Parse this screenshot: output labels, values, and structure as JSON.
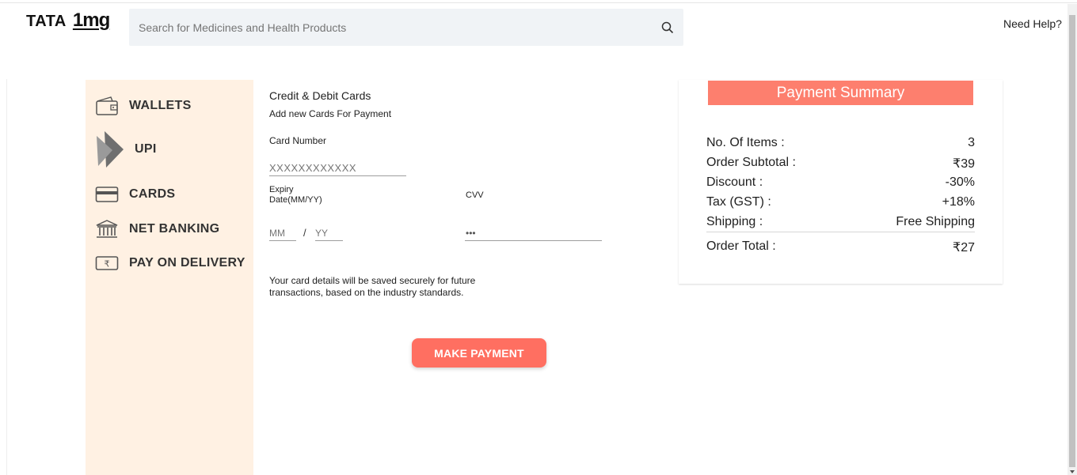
{
  "header": {
    "logo_tata": "TATA",
    "logo_1mg": "1mg",
    "search_placeholder": "Search for Medicines and Health Products",
    "help_label": "Need Help?"
  },
  "sidebar": {
    "items": [
      {
        "label": "WALLETS",
        "icon": "wallet-icon"
      },
      {
        "label": "UPI",
        "icon": "upi-icon"
      },
      {
        "label": "CARDS",
        "icon": "card-icon"
      },
      {
        "label": "NET BANKING",
        "icon": "bank-icon"
      },
      {
        "label": "PAY ON DELIVERY",
        "icon": "cash-icon"
      }
    ]
  },
  "card_form": {
    "title": "Credit & Debit Cards",
    "subtitle": "Add new Cards For Payment",
    "card_number_label": "Card Number",
    "card_number_placeholder": "XXXXXXXXXXXX",
    "expiry_label": "Expiry Date(MM/YY)",
    "cvv_label": "CVV",
    "mm_placeholder": "MM",
    "separator": "/",
    "yy_placeholder": "YY",
    "cvv_placeholder": "•••",
    "note": "Your card details will be saved securely for future transactions, based on the industry standards.",
    "submit_label": "MAKE PAYMENT"
  },
  "summary": {
    "title": "Payment Summary",
    "rows": [
      {
        "label": "No. Of Items :",
        "value": "3"
      },
      {
        "label": "Order Subtotal :",
        "value": "₹39"
      },
      {
        "label": "Discount :",
        "value": "-30%"
      },
      {
        "label": "Tax (GST) :",
        "value": "+18%"
      },
      {
        "label": "Shipping :",
        "value": "Free Shipping"
      }
    ],
    "total": {
      "label": "Order Total :",
      "value": "₹27"
    }
  },
  "colors": {
    "accent": "#fd7f6e",
    "button": "#ff6f61",
    "sidebar_bg": "#fff1e3",
    "search_bg": "#f0f3f6"
  }
}
